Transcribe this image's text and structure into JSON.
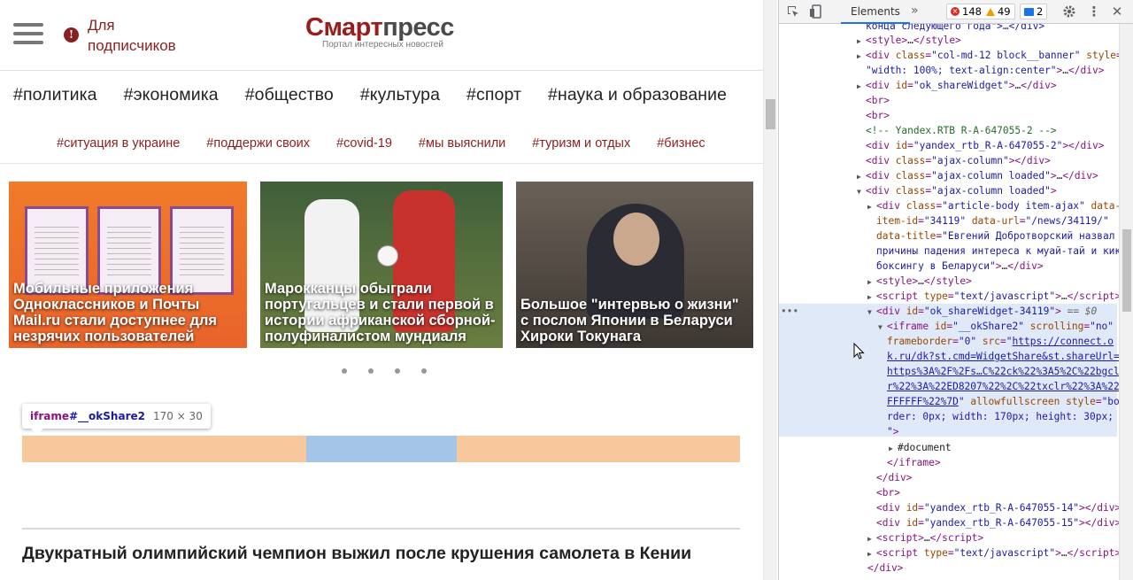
{
  "site": {
    "subscribers_label": "Для подписчиков",
    "logo_part1": "Смарт",
    "logo_part2": "пресс",
    "tagline": "Портал интересных новостей",
    "main_tags": [
      "#политика",
      "#экономика",
      "#общество",
      "#культура",
      "#спорт",
      "#наука и образование"
    ],
    "sub_tags": [
      "#ситуация в украине",
      "#поддержи своих",
      "#covid-19",
      "#мы выяснили",
      "#туризм и отдых",
      "#бизнес"
    ],
    "cards": [
      "Мобильные приложения Одноклассников и Почты Mail.ru стали доступнее для незрячих пользователей",
      "Марокканцы обыграли португальцев и стали первой в истории африканской сборной-полуфиналистом мундиаля",
      "Большое \"интервью о жизни\" с послом Японии в Беларуси Хироки Токунага"
    ],
    "tooltip": {
      "tag": "iframe",
      "id": "#__okShare2",
      "size": "170 × 30"
    },
    "article_title": "Двукратный олимпийский чемпион выжил после крушения самолета в Кении"
  },
  "devtools": {
    "tab_elements": "Elements",
    "errors": "148",
    "warnings": "49",
    "messages": "2",
    "selected_suffix": " == $0",
    "document_label": "#document"
  },
  "colors": {
    "brand": "#9b1c1c",
    "tag_red": "#8b1f1f",
    "margin_highlight": "#f6c89c",
    "content_highlight": "#a4c4e8"
  }
}
